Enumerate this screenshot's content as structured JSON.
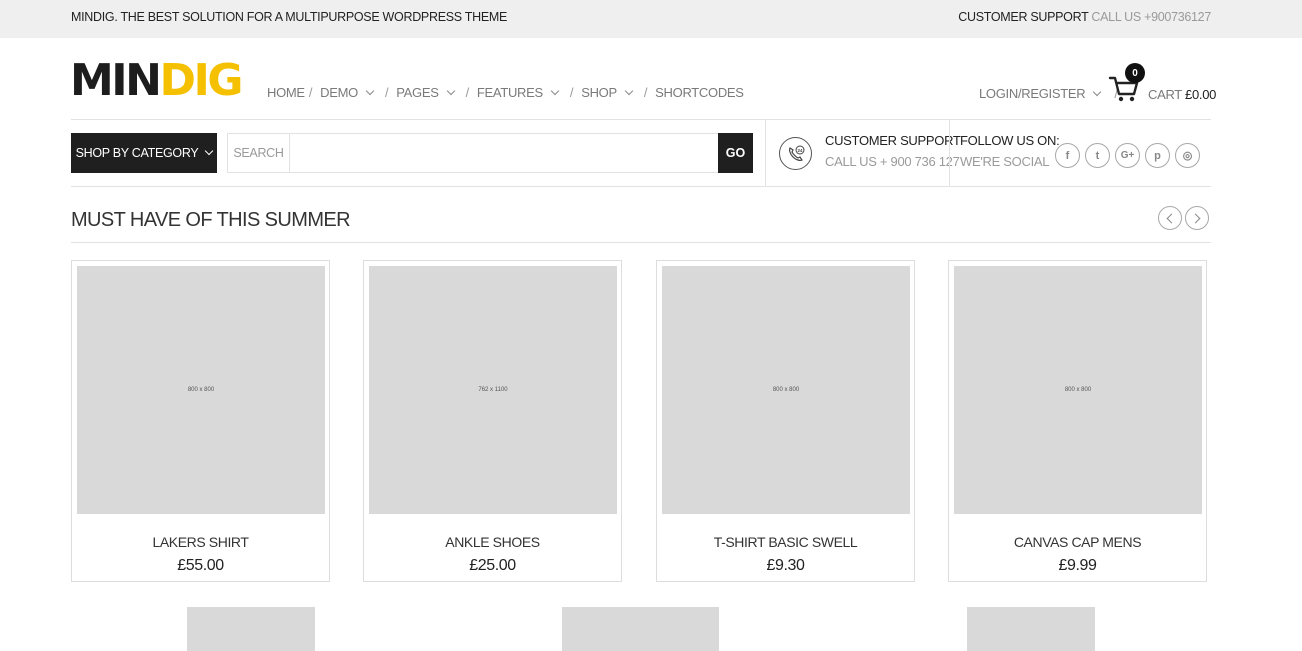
{
  "topbar": {
    "tagline": "MINDIG. THE BEST SOLUTION FOR A MULTIPURPOSE WORDPRESS THEME",
    "support_label": "CUSTOMER SUPPORT",
    "support_phone": "CALL US +900736127"
  },
  "logo": {
    "part1": "MIN",
    "part2": "DIG"
  },
  "nav": {
    "items": [
      {
        "label": "HOME"
      },
      {
        "label": "DEMO"
      },
      {
        "label": "PAGES"
      },
      {
        "label": "FEATURES"
      },
      {
        "label": "SHOP"
      },
      {
        "label": "SHORTCODES"
      }
    ],
    "separator": "/"
  },
  "account": {
    "login_label": "LOGIN/REGISTER",
    "separator": "/"
  },
  "cart": {
    "count": "0",
    "label": "CART",
    "amount": "£0.00"
  },
  "shop_by_category": "SHOP BY CATEGORY",
  "search": {
    "label": "SEARCH",
    "value": "",
    "placeholder": "",
    "go_label": "GO"
  },
  "support": {
    "title": "CUSTOMER SUPPORT",
    "phone": "CALL US + 900 736 127"
  },
  "follow": {
    "title": "FOLLOW US ON:",
    "subtitle": "WE'RE SOCIAL",
    "icons": [
      "facebook-icon",
      "twitter-icon",
      "google-plus-icon",
      "pinterest-icon",
      "instagram-icon"
    ],
    "glyphs": {
      "facebook": "f",
      "twitter": "t",
      "google_plus": "G+",
      "pinterest": "p",
      "instagram": "◎"
    }
  },
  "section": {
    "title": "MUST HAVE OF THIS SUMMER"
  },
  "products": [
    {
      "name": "LAKERS SHIRT",
      "price": "£55.00",
      "image_label": "800 x 800"
    },
    {
      "name": "ANKLE SHOES",
      "price": "£25.00",
      "image_label": "762 x 1100"
    },
    {
      "name": "T-SHIRT BASIC SWELL",
      "price": "£9.30",
      "image_label": "800 x 800"
    },
    {
      "name": "CANVAS CAP MENS",
      "price": "£9.99",
      "image_label": "800 x 800"
    }
  ],
  "colors": {
    "accent": "#f5c000",
    "dark": "#1f1f1f",
    "muted": "#9a9a9a",
    "topbar_bg": "#f0efef"
  }
}
